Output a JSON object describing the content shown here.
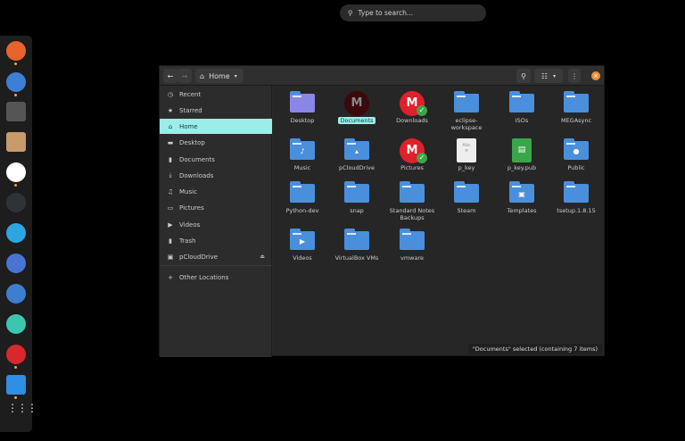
{
  "search": {
    "placeholder": "Type to search..."
  },
  "dock": {
    "apps": [
      {
        "name": "firefox",
        "color": "#e8622a",
        "running": true
      },
      {
        "name": "blue-app",
        "color": "#3d7fd6",
        "running": true
      },
      {
        "name": "terminal",
        "color": "#555555",
        "running": false
      },
      {
        "name": "launcher",
        "color": "#c99a6a",
        "running": false
      },
      {
        "name": "slack",
        "color": "#ffffff",
        "running": true
      },
      {
        "name": "timer",
        "color": "#2f3338",
        "running": false
      },
      {
        "name": "telegram",
        "color": "#2ca5e0",
        "running": false
      },
      {
        "name": "chromium",
        "color": "#4b73d4",
        "running": false
      },
      {
        "name": "simplenote",
        "color": "#3b7fd0",
        "running": false
      },
      {
        "name": "mail",
        "color": "#3cc6b0",
        "running": false
      },
      {
        "name": "mega",
        "color": "#d9272e",
        "running": true
      },
      {
        "name": "messages",
        "color": "#2f8de3",
        "running": true
      }
    ],
    "show_apps": "⋮⋮⋮"
  },
  "header": {
    "location": "Home",
    "back": "←",
    "forward": "→"
  },
  "sidebar": {
    "items": [
      {
        "label": "Recent",
        "icon": "◷"
      },
      {
        "label": "Starred",
        "icon": "★"
      },
      {
        "label": "Home",
        "icon": "⌂"
      },
      {
        "label": "Desktop",
        "icon": "▬"
      },
      {
        "label": "Documents",
        "icon": "▮"
      },
      {
        "label": "Downloads",
        "icon": "⤓"
      },
      {
        "label": "Music",
        "icon": "♫"
      },
      {
        "label": "Pictures",
        "icon": "▭"
      },
      {
        "label": "Videos",
        "icon": "▶"
      },
      {
        "label": "Trash",
        "icon": "▮"
      },
      {
        "label": "pCloudDrive",
        "icon": "▣"
      },
      {
        "label": "Other Locations",
        "icon": "+"
      }
    ]
  },
  "files": [
    {
      "name": "Desktop",
      "type": "desktop"
    },
    {
      "name": "Documents",
      "type": "mega-dark",
      "selected": true
    },
    {
      "name": "Downloads",
      "type": "mega"
    },
    {
      "name": "eclipse-workspace",
      "type": "folder"
    },
    {
      "name": "ISOs",
      "type": "folder"
    },
    {
      "name": "MEGAsync",
      "type": "folder"
    },
    {
      "name": "Music",
      "type": "folder",
      "glyph": "♪"
    },
    {
      "name": "pCloudDrive",
      "type": "folder",
      "glyph": "▴"
    },
    {
      "name": "Pictures",
      "type": "mega-err"
    },
    {
      "name": "p_key",
      "type": "text"
    },
    {
      "name": "p_key.pub",
      "type": "pub"
    },
    {
      "name": "Public",
      "type": "folder",
      "glyph": "●"
    },
    {
      "name": "Python-dev",
      "type": "folder"
    },
    {
      "name": "snap",
      "type": "folder"
    },
    {
      "name": "Standard Notes Backups",
      "type": "folder"
    },
    {
      "name": "Steam",
      "type": "folder"
    },
    {
      "name": "Templates",
      "type": "folder",
      "glyph": "▣"
    },
    {
      "name": "tsetup.1.8.15",
      "type": "folder"
    },
    {
      "name": "Videos",
      "type": "folder",
      "glyph": "▶"
    },
    {
      "name": "VirtualBox VMs",
      "type": "folder"
    },
    {
      "name": "vmware",
      "type": "folder"
    }
  ],
  "status": "\"Documents\" selected (containing 7 items)"
}
